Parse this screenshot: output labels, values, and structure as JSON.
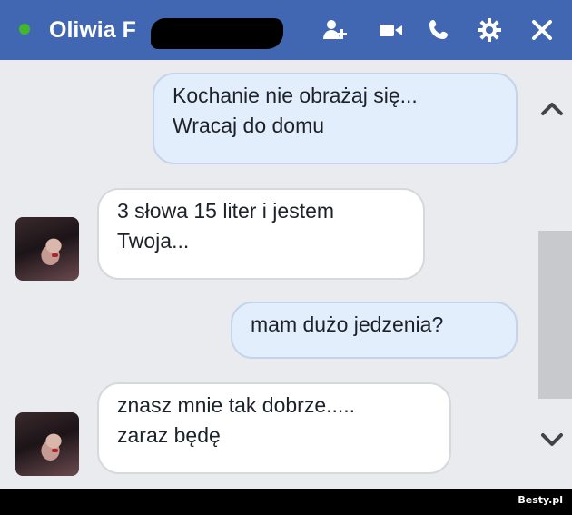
{
  "header": {
    "contact_name": "Oliwia F",
    "status": "online",
    "icons": [
      "add-friend-icon",
      "video-call-icon",
      "phone-icon",
      "settings-icon",
      "close-icon"
    ],
    "colors": {
      "bar": "#4267b2",
      "online": "#42b72a"
    }
  },
  "messages": [
    {
      "direction": "outgoing",
      "lines": [
        "Kochanie nie obrażaj się...",
        "Wracaj do domu"
      ]
    },
    {
      "direction": "incoming",
      "lines": [
        "3 słowa 15 liter i jestem",
        "Twoja..."
      ]
    },
    {
      "direction": "outgoing",
      "lines": [
        "mam dużo jedzenia?"
      ]
    },
    {
      "direction": "incoming",
      "lines": [
        "znasz mnie tak dobrze.....",
        "zaraz będę"
      ]
    }
  ],
  "scrollbar": {
    "icons": [
      "chevron-up-icon",
      "chevron-down-icon"
    ]
  },
  "watermark": {
    "text": "Besty.pl"
  }
}
